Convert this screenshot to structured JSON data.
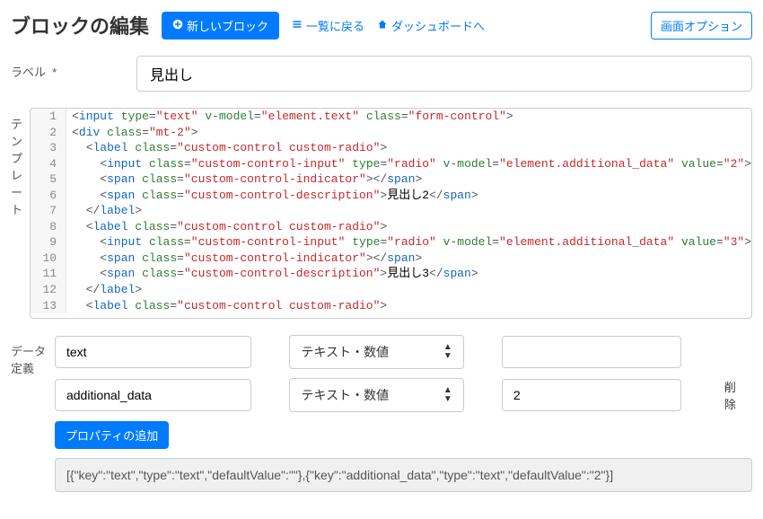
{
  "header": {
    "page_title": "ブロックの編集",
    "new_block_label": "新しいブロック",
    "back_to_list_label": "一覧に戻る",
    "to_dashboard_label": "ダッシュボードへ",
    "screen_options_label": "画面オプション"
  },
  "form": {
    "label_field": {
      "label": "ラベル",
      "required_mark": "*",
      "value": "見出し"
    },
    "template_field": {
      "label": "テンプレート",
      "lines": [
        {
          "n": 1,
          "indent": 0,
          "tokens": [
            [
              "punc",
              "<"
            ],
            [
              "tag",
              "input"
            ],
            [
              "text",
              " "
            ],
            [
              "attr",
              "type"
            ],
            [
              "punc",
              "="
            ],
            [
              "str",
              "\"text\""
            ],
            [
              "text",
              " "
            ],
            [
              "attr",
              "v-model"
            ],
            [
              "punc",
              "="
            ],
            [
              "str",
              "\"element.text\""
            ],
            [
              "text",
              " "
            ],
            [
              "attr",
              "class"
            ],
            [
              "punc",
              "="
            ],
            [
              "str",
              "\"form-control\""
            ],
            [
              "punc",
              ">"
            ]
          ]
        },
        {
          "n": 2,
          "indent": 0,
          "tokens": [
            [
              "punc",
              "<"
            ],
            [
              "tag",
              "div"
            ],
            [
              "text",
              " "
            ],
            [
              "attr",
              "class"
            ],
            [
              "punc",
              "="
            ],
            [
              "str",
              "\"mt-2\""
            ],
            [
              "punc",
              ">"
            ]
          ]
        },
        {
          "n": 3,
          "indent": 1,
          "tokens": [
            [
              "punc",
              "<"
            ],
            [
              "tag",
              "label"
            ],
            [
              "text",
              " "
            ],
            [
              "attr",
              "class"
            ],
            [
              "punc",
              "="
            ],
            [
              "str",
              "\"custom-control custom-radio\""
            ],
            [
              "punc",
              ">"
            ]
          ]
        },
        {
          "n": 4,
          "indent": 2,
          "tokens": [
            [
              "punc",
              "<"
            ],
            [
              "tag",
              "input"
            ],
            [
              "text",
              " "
            ],
            [
              "attr",
              "class"
            ],
            [
              "punc",
              "="
            ],
            [
              "str",
              "\"custom-control-input\""
            ],
            [
              "text",
              " "
            ],
            [
              "attr",
              "type"
            ],
            [
              "punc",
              "="
            ],
            [
              "str",
              "\"radio\""
            ],
            [
              "text",
              " "
            ],
            [
              "attr",
              "v-model"
            ],
            [
              "punc",
              "="
            ],
            [
              "str",
              "\"element.additional_data\""
            ],
            [
              "text",
              " "
            ],
            [
              "attr",
              "value"
            ],
            [
              "punc",
              "="
            ],
            [
              "str",
              "\"2\""
            ],
            [
              "punc",
              ">"
            ]
          ]
        },
        {
          "n": 5,
          "indent": 2,
          "tokens": [
            [
              "punc",
              "<"
            ],
            [
              "tag",
              "span"
            ],
            [
              "text",
              " "
            ],
            [
              "attr",
              "class"
            ],
            [
              "punc",
              "="
            ],
            [
              "str",
              "\"custom-control-indicator\""
            ],
            [
              "punc",
              ">"
            ],
            [
              "punc",
              "</"
            ],
            [
              "tag",
              "span"
            ],
            [
              "punc",
              ">"
            ]
          ]
        },
        {
          "n": 6,
          "indent": 2,
          "tokens": [
            [
              "punc",
              "<"
            ],
            [
              "tag",
              "span"
            ],
            [
              "text",
              " "
            ],
            [
              "attr",
              "class"
            ],
            [
              "punc",
              "="
            ],
            [
              "str",
              "\"custom-control-description\""
            ],
            [
              "punc",
              ">"
            ],
            [
              "text",
              "見出し2"
            ],
            [
              "punc",
              "</"
            ],
            [
              "tag",
              "span"
            ],
            [
              "punc",
              ">"
            ]
          ]
        },
        {
          "n": 7,
          "indent": 1,
          "tokens": [
            [
              "punc",
              "</"
            ],
            [
              "tag",
              "label"
            ],
            [
              "punc",
              ">"
            ]
          ]
        },
        {
          "n": 8,
          "indent": 1,
          "tokens": [
            [
              "punc",
              "<"
            ],
            [
              "tag",
              "label"
            ],
            [
              "text",
              " "
            ],
            [
              "attr",
              "class"
            ],
            [
              "punc",
              "="
            ],
            [
              "str",
              "\"custom-control custom-radio\""
            ],
            [
              "punc",
              ">"
            ]
          ]
        },
        {
          "n": 9,
          "indent": 2,
          "tokens": [
            [
              "punc",
              "<"
            ],
            [
              "tag",
              "input"
            ],
            [
              "text",
              " "
            ],
            [
              "attr",
              "class"
            ],
            [
              "punc",
              "="
            ],
            [
              "str",
              "\"custom-control-input\""
            ],
            [
              "text",
              " "
            ],
            [
              "attr",
              "type"
            ],
            [
              "punc",
              "="
            ],
            [
              "str",
              "\"radio\""
            ],
            [
              "text",
              " "
            ],
            [
              "attr",
              "v-model"
            ],
            [
              "punc",
              "="
            ],
            [
              "str",
              "\"element.additional_data\""
            ],
            [
              "text",
              " "
            ],
            [
              "attr",
              "value"
            ],
            [
              "punc",
              "="
            ],
            [
              "str",
              "\"3\""
            ],
            [
              "punc",
              ">"
            ]
          ]
        },
        {
          "n": 10,
          "indent": 2,
          "tokens": [
            [
              "punc",
              "<"
            ],
            [
              "tag",
              "span"
            ],
            [
              "text",
              " "
            ],
            [
              "attr",
              "class"
            ],
            [
              "punc",
              "="
            ],
            [
              "str",
              "\"custom-control-indicator\""
            ],
            [
              "punc",
              ">"
            ],
            [
              "punc",
              "</"
            ],
            [
              "tag",
              "span"
            ],
            [
              "punc",
              ">"
            ]
          ]
        },
        {
          "n": 11,
          "indent": 2,
          "tokens": [
            [
              "punc",
              "<"
            ],
            [
              "tag",
              "span"
            ],
            [
              "text",
              " "
            ],
            [
              "attr",
              "class"
            ],
            [
              "punc",
              "="
            ],
            [
              "str",
              "\"custom-control-description\""
            ],
            [
              "punc",
              ">"
            ],
            [
              "text",
              "見出し3"
            ],
            [
              "punc",
              "</"
            ],
            [
              "tag",
              "span"
            ],
            [
              "punc",
              ">"
            ]
          ]
        },
        {
          "n": 12,
          "indent": 1,
          "tokens": [
            [
              "punc",
              "</"
            ],
            [
              "tag",
              "label"
            ],
            [
              "punc",
              ">"
            ]
          ]
        },
        {
          "n": 13,
          "indent": 1,
          "tokens": [
            [
              "punc",
              "<"
            ],
            [
              "tag",
              "label"
            ],
            [
              "text",
              " "
            ],
            [
              "attr",
              "class"
            ],
            [
              "punc",
              "="
            ],
            [
              "str",
              "\"custom-control custom-radio\""
            ],
            [
              "punc",
              ">"
            ]
          ]
        }
      ]
    },
    "data_def_field": {
      "label": "データ定義",
      "type_option": "テキスト・数値",
      "add_property_label": "プロパティの追加",
      "delete_label": "削除",
      "rows": [
        {
          "key": "text",
          "value": ""
        },
        {
          "key": "additional_data",
          "value": "2"
        }
      ],
      "json_preview": "[{\"key\":\"text\",\"type\":\"text\",\"defaultValue\":\"\"},{\"key\":\"additional_data\",\"type\":\"text\",\"defaultValue\":\"2\"}]"
    }
  }
}
